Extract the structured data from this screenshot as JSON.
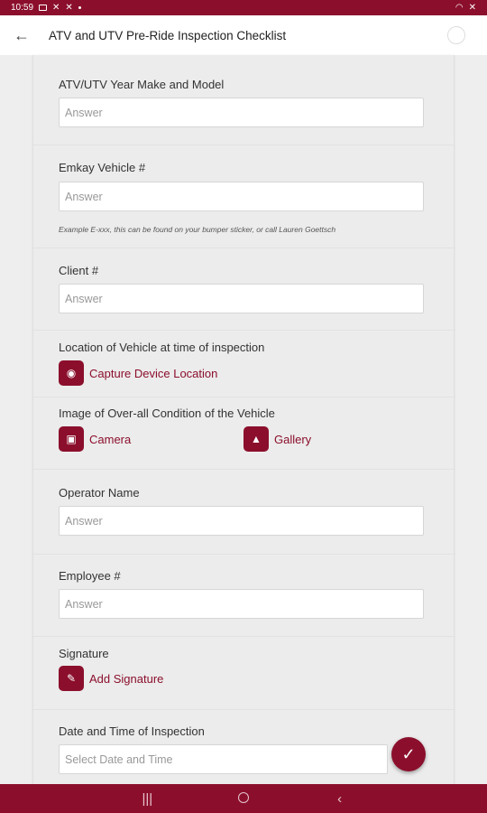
{
  "status_bar": {
    "time": "10:59"
  },
  "app_bar": {
    "title": "ATV and UTV Pre-Ride Inspection Checklist",
    "back_icon": "back-arrow-icon"
  },
  "colors": {
    "accent": "#8b0f2c",
    "background": "#eeeeee",
    "input_bg": "#ffffff"
  },
  "form": {
    "q1": {
      "label": "ATV/UTV Year Make and Model",
      "placeholder": "Answer"
    },
    "q2": {
      "label": "Emkay Vehicle #",
      "placeholder": "Answer",
      "hint": "Example E-xxx, this can be found on your bumper sticker, or call Lauren Goettsch"
    },
    "q3": {
      "label": "Client #",
      "placeholder": "Answer"
    },
    "q4": {
      "label": "Location of Vehicle at time of inspection",
      "action": "Capture Device Location",
      "icon": "location-target-icon"
    },
    "q5": {
      "label": "Image of Over-all Condition of the Vehicle",
      "camera": "Camera",
      "gallery": "Gallery"
    },
    "q6": {
      "label": "Operator Name",
      "placeholder": "Answer"
    },
    "q7": {
      "label": "Employee #",
      "placeholder": "Answer"
    },
    "q8": {
      "label": "Signature",
      "action": "Add Signature",
      "icon": "signature-icon"
    },
    "q9": {
      "label": "Date and Time of Inspection",
      "placeholder": "Select Date and Time"
    }
  },
  "fab": {
    "icon": "check-icon"
  },
  "nav_bar": {
    "icons": [
      "recent-apps-icon",
      "home-icon",
      "back-nav-icon"
    ]
  }
}
